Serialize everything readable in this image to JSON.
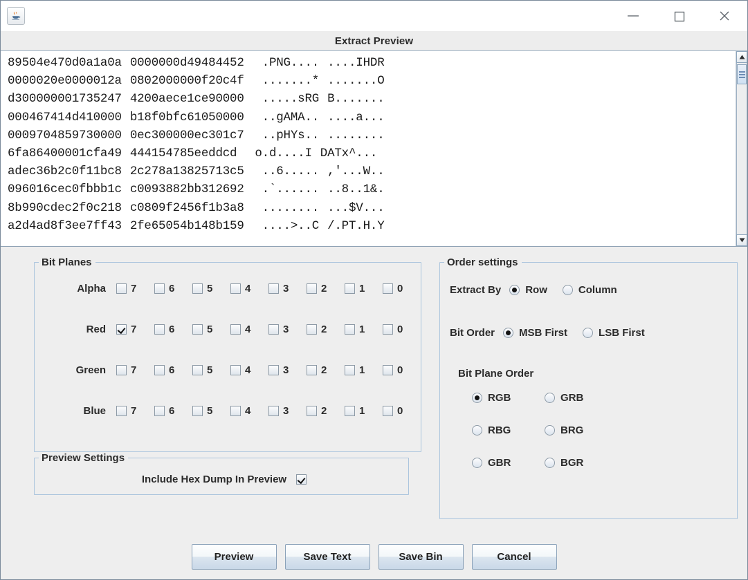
{
  "window": {
    "app_icon": "java-coffee-cup-icon",
    "buttons": {
      "minimize": "minimize-icon",
      "maximize": "maximize-icon",
      "close": "close-icon"
    }
  },
  "dialog": {
    "title": "Extract Preview"
  },
  "hex_preview": {
    "lines": [
      {
        "hex_left": "89504e470d0a1a0a",
        "hex_right": "0000000d49484452",
        "ascii_left": ".PNG....",
        "ascii_right": "....IHDR"
      },
      {
        "hex_left": "0000020e0000012a",
        "hex_right": "0802000000f20c4f",
        "ascii_left": ".......*",
        "ascii_right": ".......O"
      },
      {
        "hex_left": "d300000001735247",
        "hex_right": "4200aece1ce90000",
        "ascii_left": ".....sRG",
        "ascii_right": "B......."
      },
      {
        "hex_left": "000467414d410000",
        "hex_right": "b18f0bfc61050000",
        "ascii_left": "..gAMA..",
        "ascii_right": "....a..."
      },
      {
        "hex_left": "0009704859730000",
        "hex_right": "0ec300000ec301c7",
        "ascii_left": "..pHYs..",
        "ascii_right": "........"
      },
      {
        "hex_left": "6fa86400001cfa49",
        "hex_right": "444154785eeddcd",
        "ascii_left": "o.d....I",
        "ascii_right": "DATx^..."
      },
      {
        "hex_left": "adec36b2c0f11bc8",
        "hex_right": "2c278a13825713c5",
        "ascii_left": "..6.....",
        "ascii_right": ",'...W.."
      },
      {
        "hex_left": "096016cec0fbbb1c",
        "hex_right": "c0093882bb312692",
        "ascii_left": ".`......",
        "ascii_right": "..8..1&."
      },
      {
        "hex_left": "8b990cdec2f0c218",
        "hex_right": "c0809f2456f1b3a8",
        "ascii_left": "........",
        "ascii_right": "...$V..."
      },
      {
        "hex_left": "a2d4ad8f3ee7ff43",
        "hex_right": "2fe65054b148b159",
        "ascii_left": "....>..C",
        "ascii_right": "/.PT.H.Y"
      }
    ],
    "scrollbar": {
      "up_arrow": "scroll-up-icon",
      "down_arrow": "scroll-down-icon"
    }
  },
  "bit_planes": {
    "legend": "Bit Planes",
    "bits": [
      "7",
      "6",
      "5",
      "4",
      "3",
      "2",
      "1",
      "0"
    ],
    "channels": [
      {
        "label": "Alpha",
        "checked": [
          false,
          false,
          false,
          false,
          false,
          false,
          false,
          false
        ]
      },
      {
        "label": "Red",
        "checked": [
          true,
          false,
          false,
          false,
          false,
          false,
          false,
          false
        ]
      },
      {
        "label": "Green",
        "checked": [
          false,
          false,
          false,
          false,
          false,
          false,
          false,
          false
        ]
      },
      {
        "label": "Blue",
        "checked": [
          false,
          false,
          false,
          false,
          false,
          false,
          false,
          false
        ]
      }
    ]
  },
  "preview_settings": {
    "legend": "Preview Settings",
    "include_hex_dump_label": "Include Hex Dump In Preview",
    "include_hex_dump_checked": true
  },
  "order_settings": {
    "legend": "Order settings",
    "extract_by": {
      "label": "Extract By",
      "options": [
        {
          "label": "Row",
          "selected": true
        },
        {
          "label": "Column",
          "selected": false
        }
      ]
    },
    "bit_order": {
      "label": "Bit Order",
      "options": [
        {
          "label": "MSB First",
          "selected": true
        },
        {
          "label": "LSB First",
          "selected": false
        }
      ]
    },
    "bit_plane_order": {
      "label": "Bit Plane Order",
      "options": [
        {
          "label": "RGB",
          "selected": true
        },
        {
          "label": "GRB",
          "selected": false
        },
        {
          "label": "RBG",
          "selected": false
        },
        {
          "label": "BRG",
          "selected": false
        },
        {
          "label": "GBR",
          "selected": false
        },
        {
          "label": "BGR",
          "selected": false
        }
      ]
    }
  },
  "actions": {
    "buttons": [
      {
        "label": "Preview"
      },
      {
        "label": "Save Text"
      },
      {
        "label": "Save Bin"
      },
      {
        "label": "Cancel"
      }
    ]
  }
}
